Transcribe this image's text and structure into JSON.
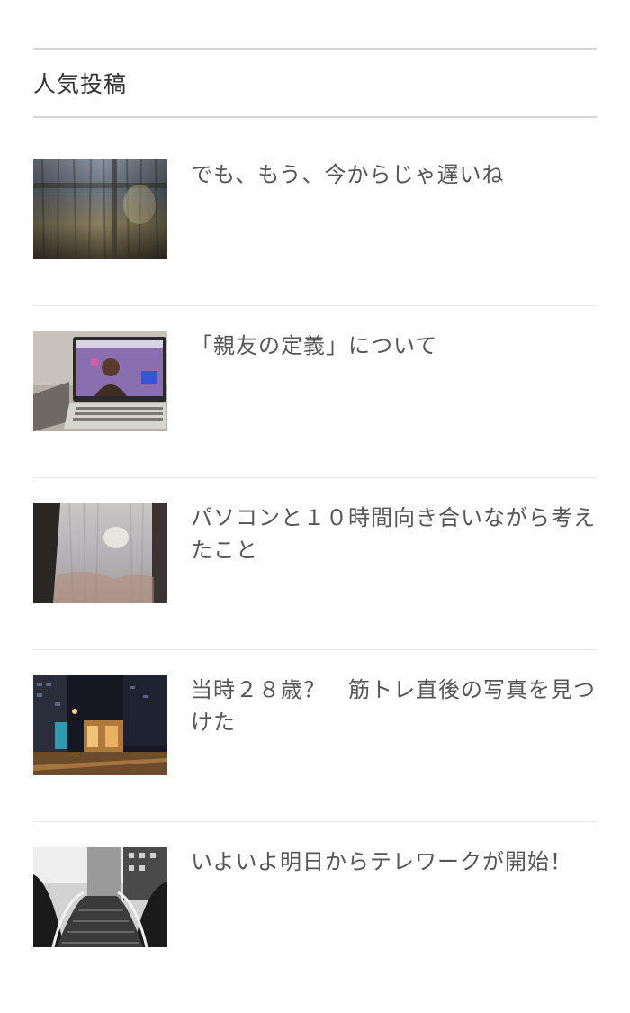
{
  "widget": {
    "title": "人気投稿"
  },
  "posts": [
    {
      "title": "でも、もう、今からじゃ遅いね",
      "thumbnail": "curtain-window-image"
    },
    {
      "title": "「親友の定義」について",
      "thumbnail": "laptop-video-call-image"
    },
    {
      "title": "パソコンと１０時間向き合いながら考えたこと",
      "thumbnail": "sheer-curtain-image"
    },
    {
      "title": "当時２８歳？　筋トレ直後の写真を見つけた",
      "thumbnail": "night-street-image"
    },
    {
      "title": "いよいよ明日からテレワークが開始！",
      "thumbnail": "escalator-image"
    }
  ]
}
